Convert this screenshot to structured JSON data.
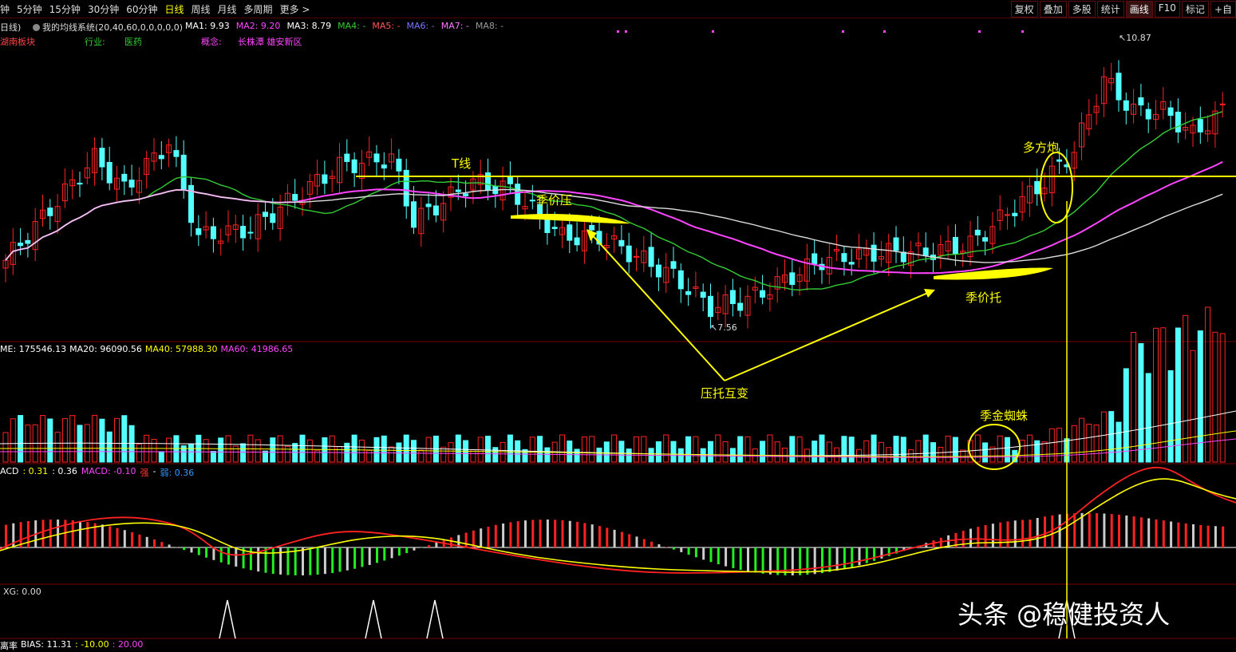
{
  "toolbar": {
    "tabs": [
      "钟",
      "5分钟",
      "15分钟",
      "30分钟",
      "60分钟",
      "日线",
      "周线",
      "月线",
      "多周期",
      "更多 >"
    ],
    "active_tab": "日线",
    "tools": [
      "复权",
      "叠加",
      "多股",
      "统计",
      "画线",
      "F10",
      "标记",
      "+自"
    ]
  },
  "header": {
    "period": "日线)",
    "indicator": "我的均线系统(20,40,60,0,0,0,0,0)",
    "ma": [
      {
        "label": "MA1: 9.93",
        "color": "#ffffff"
      },
      {
        "label": "MA2: 9.20",
        "color": "#ff44ff"
      },
      {
        "label": "MA3: 8.79",
        "color": "#ffffff"
      },
      {
        "label": "MA4: -",
        "color": "#33cc33"
      },
      {
        "label": "MA5: -",
        "color": "#ff5555"
      },
      {
        "label": "MA6: -",
        "color": "#7777ff"
      },
      {
        "label": "MA7: -",
        "color": "#ff77ff"
      },
      {
        "label": "MA8: -",
        "color": "#999999"
      }
    ],
    "block": "湖南板块",
    "industry_label": "行业:",
    "industry": "医药",
    "concept_label": "概念:",
    "concept": "长株潭 雄安新区"
  },
  "price_labels": {
    "high": "10.87",
    "low": "7.56"
  },
  "annotations": {
    "t_line": "T线",
    "season_pressure": "季价压",
    "season_support": "季价托",
    "multi_cannon": "多方炮",
    "pressure_support_switch": "压托互变",
    "season_spider": "季金蜘蛛"
  },
  "volume_header": [
    {
      "label": "ME: 175546.13",
      "color": "#ffffff"
    },
    {
      "label": "MA20: 96090.56",
      "color": "#ffffff"
    },
    {
      "label": "MA40: 57988.30",
      "color": "#ffff00"
    },
    {
      "label": "MA60: 41986.65",
      "color": "#ff44ff"
    }
  ],
  "macd_header": [
    {
      "label": "ACD",
      "color": "#ffffff"
    },
    {
      "label": ": 0.31",
      "color": "#ffff00"
    },
    {
      "label": ": 0.36",
      "color": "#ffffff"
    },
    {
      "label": "MACD: -0.10",
      "color": "#ff44ff"
    },
    {
      "label": "强",
      "color": "#ff3333"
    },
    {
      "label": "-",
      "color": "#ffffff"
    },
    {
      "label": "弱: 0.36",
      "color": "#3399ff"
    }
  ],
  "xg_header": "XG: 0.00",
  "bias_header": [
    {
      "label": "离率",
      "color": "#ffffff"
    },
    {
      "label": "BIAS: 11.31",
      "color": "#ffffff"
    },
    {
      "label": ": -10.00",
      "color": "#ffff00"
    },
    {
      "label": ": 20.00",
      "color": "#ff44ff"
    }
  ],
  "watermark": "头条 @稳健投资人",
  "colors": {
    "up": "#ff2222",
    "down": "#54ffff",
    "ma20": "#33cc33",
    "ma40": "#ff44ff",
    "ma60": "#dddddd",
    "annot": "#ffff00",
    "grid": "#5a0000"
  }
}
